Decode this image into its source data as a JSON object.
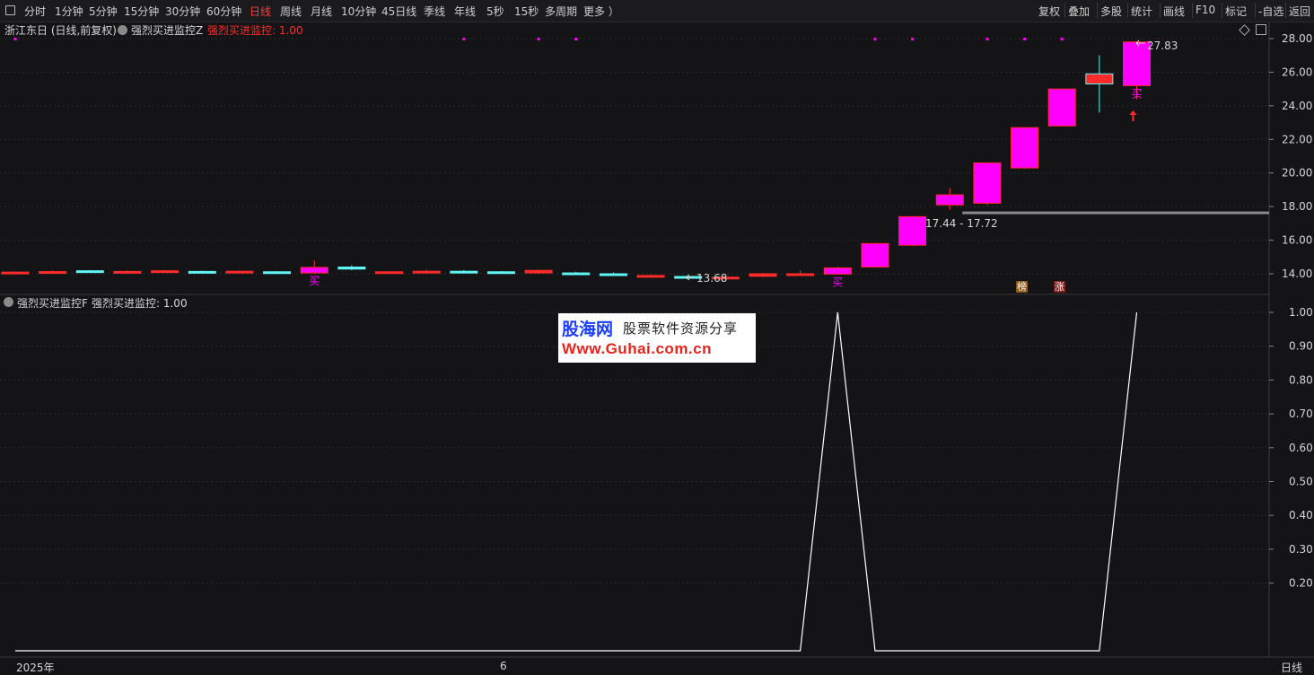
{
  "toolbar": {
    "left_icon": "panel-icon",
    "periods": [
      "分时",
      "1分钟",
      "5分钟",
      "15分钟",
      "30分钟",
      "60分钟",
      "日线",
      "周线",
      "月线",
      "10分钟",
      "45日线",
      "季线",
      "年线",
      "5秒",
      "15秒",
      "多周期",
      "更多 ）"
    ],
    "active_period": "日线",
    "right_items": [
      "复权",
      "叠加",
      "多股",
      "统计",
      "画线",
      "F10",
      "标记",
      "-自选",
      "返回"
    ]
  },
  "main_panel": {
    "stock_title": "浙江东日 (日线,前复权)",
    "indicator_name": "强烈买进监控Z",
    "indicator_value": "强烈买进监控: 1.00",
    "y_axis_ticks": [
      "28.00",
      "26.00",
      "24.00",
      "22.00",
      "20.00",
      "18.00",
      "16.00",
      "14.00"
    ],
    "high_label": "27.83",
    "low_label": "13.68",
    "range_label": "17.44 - 17.72",
    "buy_marker": "买",
    "badges": [
      "榜",
      "涨"
    ],
    "colors": {
      "up": "#ff2a2a",
      "strong": "#ff00ff",
      "down": "#5ff5f5",
      "signal": "#ff00ff"
    }
  },
  "sub_panel": {
    "indicator_name": "强烈买进监控F",
    "indicator_value": "强烈买进监控: 1.00",
    "y_axis_ticks": [
      "1.00",
      "0.90",
      "0.80",
      "0.70",
      "0.60",
      "0.50",
      "0.40",
      "0.30",
      "0.20"
    ]
  },
  "x_axis": {
    "labels": [
      "2025年",
      "6"
    ],
    "period_label": "日线"
  },
  "watermark": {
    "line1": "股海网",
    "line2": "股票软件资源分享",
    "line3": "Www.Guhai.com.cn"
  },
  "chart_data": {
    "type": "candlestick",
    "candles": [
      {
        "o": 14.08,
        "c": 14.1,
        "h": 14.14,
        "l": 14.05,
        "t": "up"
      },
      {
        "o": 14.1,
        "c": 14.13,
        "h": 14.2,
        "l": 14.05,
        "t": "up"
      },
      {
        "o": 14.18,
        "c": 14.12,
        "h": 14.22,
        "l": 14.08,
        "t": "down"
      },
      {
        "o": 14.1,
        "c": 14.14,
        "h": 14.2,
        "l": 14.06,
        "t": "up"
      },
      {
        "o": 14.15,
        "c": 14.18,
        "h": 14.22,
        "l": 14.12,
        "t": "up"
      },
      {
        "o": 14.14,
        "c": 14.12,
        "h": 14.18,
        "l": 14.08,
        "t": "down"
      },
      {
        "o": 14.1,
        "c": 14.15,
        "h": 14.2,
        "l": 14.06,
        "t": "up"
      },
      {
        "o": 14.12,
        "c": 14.1,
        "h": 14.16,
        "l": 14.06,
        "t": "down"
      },
      {
        "o": 14.05,
        "c": 14.38,
        "h": 14.8,
        "l": 14.0,
        "t": "strong"
      },
      {
        "o": 14.4,
        "c": 14.28,
        "h": 14.5,
        "l": 14.22,
        "t": "down"
      },
      {
        "o": 14.1,
        "c": 14.12,
        "h": 14.16,
        "l": 14.06,
        "t": "up"
      },
      {
        "o": 14.08,
        "c": 14.15,
        "h": 14.25,
        "l": 14.02,
        "t": "up"
      },
      {
        "o": 14.15,
        "c": 14.12,
        "h": 14.22,
        "l": 14.08,
        "t": "down"
      },
      {
        "o": 14.1,
        "c": 14.12,
        "h": 14.16,
        "l": 14.06,
        "t": "down"
      },
      {
        "o": 14.05,
        "c": 14.2,
        "h": 14.25,
        "l": 14.0,
        "t": "up"
      },
      {
        "o": 14.05,
        "c": 13.98,
        "h": 14.12,
        "l": 13.92,
        "t": "down"
      },
      {
        "o": 14.0,
        "c": 13.93,
        "h": 14.08,
        "l": 13.88,
        "t": "down"
      },
      {
        "o": 13.88,
        "c": 13.9,
        "h": 13.95,
        "l": 13.84,
        "t": "up"
      },
      {
        "o": 13.84,
        "c": 13.78,
        "h": 13.9,
        "l": 13.68,
        "t": "down"
      },
      {
        "o": 13.78,
        "c": 13.8,
        "h": 13.86,
        "l": 13.74,
        "t": "up"
      },
      {
        "o": 13.85,
        "c": 14.0,
        "h": 14.06,
        "l": 13.8,
        "t": "up"
      },
      {
        "o": 13.95,
        "c": 14.0,
        "h": 14.2,
        "l": 13.9,
        "t": "up"
      },
      {
        "o": 13.98,
        "c": 14.35,
        "h": 14.42,
        "l": 13.95,
        "t": "strong"
      },
      {
        "o": 14.4,
        "c": 15.8,
        "h": 15.8,
        "l": 14.4,
        "t": "strong"
      },
      {
        "o": 15.7,
        "c": 17.4,
        "h": 17.44,
        "l": 15.65,
        "t": "strong"
      },
      {
        "o": 18.1,
        "c": 18.7,
        "h": 19.1,
        "l": 17.8,
        "t": "strong"
      },
      {
        "o": 18.2,
        "c": 20.6,
        "h": 20.6,
        "l": 18.1,
        "t": "strong"
      },
      {
        "o": 20.3,
        "c": 22.7,
        "h": 22.7,
        "l": 20.25,
        "t": "strong"
      },
      {
        "o": 22.8,
        "c": 25.0,
        "h": 25.0,
        "l": 22.8,
        "t": "strong"
      },
      {
        "o": 25.9,
        "c": 25.3,
        "h": 27.0,
        "l": 23.6,
        "t": "up-box"
      },
      {
        "o": 25.2,
        "c": 27.8,
        "h": 27.83,
        "l": 24.4,
        "t": "strong"
      }
    ],
    "signal_values": [
      0,
      0,
      0,
      0,
      0,
      0,
      0,
      0,
      0,
      0,
      0,
      0,
      0,
      0,
      0,
      0,
      0,
      0,
      0,
      0,
      0,
      0,
      1,
      0,
      0,
      0,
      0,
      0,
      0,
      0,
      1
    ],
    "signal_markers_top": [
      0,
      12,
      14,
      15,
      23,
      24,
      26,
      27,
      28
    ],
    "buy_signal_indices": [
      8,
      22,
      30
    ],
    "level_line": {
      "from_index": 25,
      "value": 17.6
    },
    "y_range": [
      13.3,
      28.4
    ],
    "sub_y_range": [
      0,
      1.0
    ]
  }
}
